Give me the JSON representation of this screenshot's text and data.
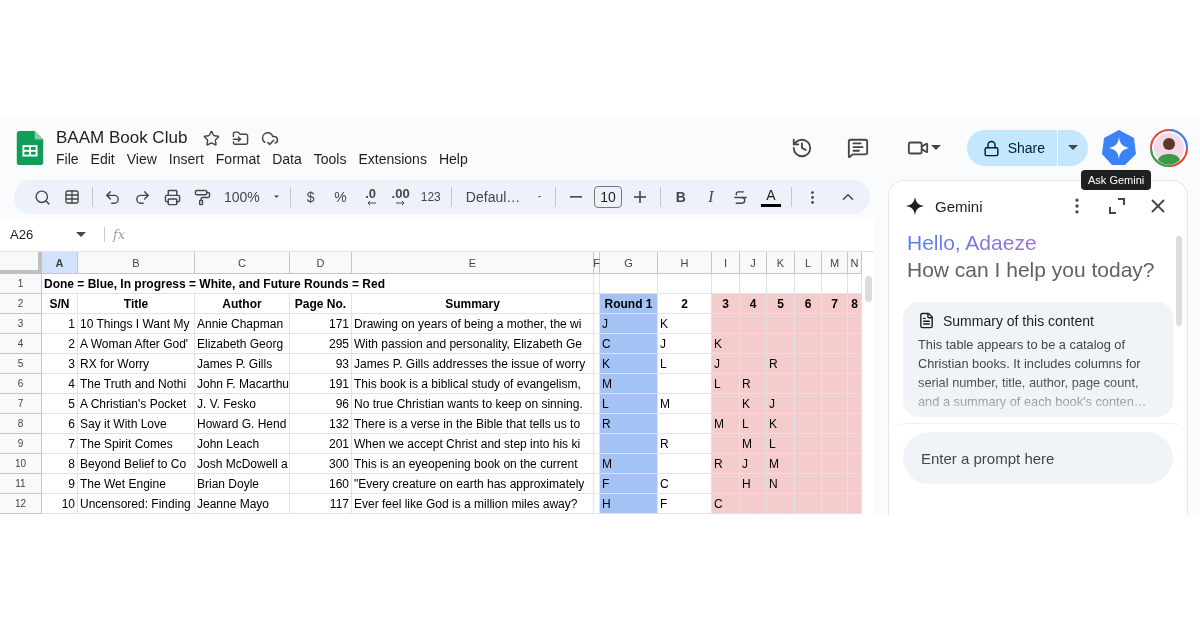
{
  "document": {
    "title": "BAAM Book Club"
  },
  "menu": [
    "File",
    "Edit",
    "View",
    "Insert",
    "Format",
    "Data",
    "Tools",
    "Extensions",
    "Help"
  ],
  "share": {
    "label": "Share"
  },
  "tooltip": "Ask Gemini",
  "toolbar": {
    "zoom": "100%",
    "currency": "$",
    "percent": "%",
    "decrease_decimal": ".0",
    "increase_decimal": ".00",
    "number_format": "123",
    "font": "Defaul…",
    "font_size": "10",
    "bold": "B",
    "italic": "I",
    "text_color": "A"
  },
  "formula_bar": {
    "cell": "A26",
    "label": "fx"
  },
  "sheet": {
    "columns": [
      {
        "letter": "A",
        "selected": true
      },
      {
        "letter": "B",
        "selected": false
      },
      {
        "letter": "C",
        "selected": false
      },
      {
        "letter": "D",
        "selected": false
      },
      {
        "letter": "E",
        "selected": false
      },
      {
        "letter": "F",
        "selected": false
      },
      {
        "letter": "G",
        "selected": false,
        "color": "#a4c2f4"
      },
      {
        "letter": "H",
        "selected": false
      },
      {
        "letter": "I",
        "selected": false,
        "color": "#f4cccc"
      },
      {
        "letter": "J",
        "selected": false,
        "color": "#f4cccc"
      },
      {
        "letter": "K",
        "selected": false,
        "color": "#f4cccc"
      },
      {
        "letter": "L",
        "selected": false,
        "color": "#f4cccc"
      },
      {
        "letter": "M",
        "selected": false,
        "color": "#f4cccc"
      },
      {
        "letter": "N",
        "selected": false,
        "color": "#f4cccc"
      }
    ],
    "rows": [
      {
        "number": "1",
        "kind": "note",
        "text": "Done = Blue, In progress = White, and Future Rounds = Red"
      },
      {
        "number": "2",
        "kind": "header",
        "cells": {
          "A": "S/N",
          "B": "Title",
          "C": "Author",
          "D": "Page No.",
          "E": "Summary",
          "G": "Round 1",
          "H": "2",
          "I": "3",
          "J": "4",
          "K": "5",
          "L": "6",
          "M": "7",
          "N": "8"
        }
      },
      {
        "number": "3",
        "kind": "data",
        "cells": {
          "A": "1",
          "B": "10 Things I Want My",
          "C": "Annie Chapman",
          "D": "171",
          "E": "Drawing on years of being a mother, the wi",
          "G": "J",
          "H": "K"
        }
      },
      {
        "number": "4",
        "kind": "data",
        "cells": {
          "A": "2",
          "B": "A Woman After God'",
          "C": "Elizabeth Georg",
          "D": "295",
          "E": "With passion and personality, Elizabeth Ge",
          "G": "C",
          "H": "J",
          "I": "K"
        }
      },
      {
        "number": "5",
        "kind": "data",
        "cells": {
          "A": "3",
          "B": "RX for Worry",
          "C": "James P. Gills",
          "D": "93",
          "E": "James P. Gills addresses the issue of worry",
          "G": "K",
          "H": "L",
          "I": "J",
          "K": "R"
        }
      },
      {
        "number": "6",
        "kind": "data",
        "cells": {
          "A": "4",
          "B": "The Truth and Nothi",
          "C": "John F. Macarthu",
          "D": "191",
          "E": "This book is a biblical study of evangelism,",
          "G": "M",
          "I": "L",
          "J": "R"
        }
      },
      {
        "number": "7",
        "kind": "data",
        "cells": {
          "A": "5",
          "B": "A Christian's Pocket",
          "C": "J. V. Fesko",
          "D": "96",
          "E": "No true Christian wants to keep on sinning.",
          "G": "L",
          "H": "M",
          "J": "K",
          "K": "J"
        }
      },
      {
        "number": "8",
        "kind": "data",
        "cells": {
          "A": "6",
          "B": "Say it With Love",
          "C": "Howard G. Hend",
          "D": "132",
          "E": "There is a verse in the Bible that tells us to",
          "G": "R",
          "I": "M",
          "J": "L",
          "K": "K"
        }
      },
      {
        "number": "9",
        "kind": "data",
        "cells": {
          "A": "7",
          "B": "The Spirit Comes",
          "C": "John Leach",
          "D": "201",
          "E": "When we accept Christ and step into his ki",
          "H": "R",
          "J": "M",
          "K": "L"
        }
      },
      {
        "number": "10",
        "kind": "data",
        "cells": {
          "A": "8",
          "B": "Beyond Belief to Co",
          "C": "Josh McDowell a",
          "D": "300",
          "E": "This is an eyeopening book on the current",
          "G": "M",
          "I": "R",
          "J": "J",
          "K": "M"
        }
      },
      {
        "number": "11",
        "kind": "data",
        "cells": {
          "A": "9",
          "B": "The Wet Engine",
          "C": "Brian Doyle",
          "D": "160",
          "E": "\"Every creature on earth has approximately",
          "G": "F",
          "H": "C",
          "J": "H",
          "K": "N"
        }
      },
      {
        "number": "12",
        "kind": "data",
        "cells": {
          "A": "10",
          "B": "Uncensored: Finding",
          "C": "Jeanne Mayo",
          "D": "117",
          "E": "Ever feel like God is a million miles away?",
          "G": "H",
          "H": "F",
          "I": "C"
        }
      }
    ]
  },
  "gemini": {
    "title": "Gemini",
    "greeting": "Hello, Adaeze",
    "question": "How can I help you today?",
    "card": {
      "title": "Summary of this content",
      "text": "This table appears to be a catalog of Christian books. It includes columns for serial number, title, author, page count, and a summary of each book's conten…"
    },
    "prompt": {
      "placeholder": "Enter a prompt here"
    }
  }
}
